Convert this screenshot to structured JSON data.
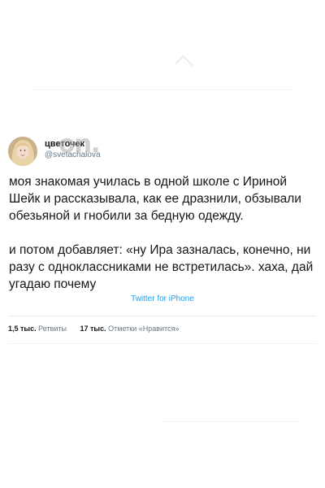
{
  "tweet": {
    "display_name": "цветочек",
    "handle": "@svetachalova",
    "watermark": "on.",
    "paragraphs": [
      "моя знакомая училась в одной школе с Ириной Шейк и рассказывала, как ее дразнили, обзывали обезьяной и гнобили за бедную одежду.",
      "и потом добавляет: «ну Ира зазналась, конечно, ни разу с одноклассниками не встретилась». хаха, дай угадаю почему"
    ],
    "source": "Twitter for iPhone",
    "stats": {
      "retweets_count": "1,5 тыс.",
      "retweets_label": "Ретвиты",
      "likes_count": "17 тыс.",
      "likes_label": "Отметки «Нравится»"
    }
  },
  "colors": {
    "accent": "#1da1f2",
    "text": "#14171a",
    "muted": "#657786"
  }
}
